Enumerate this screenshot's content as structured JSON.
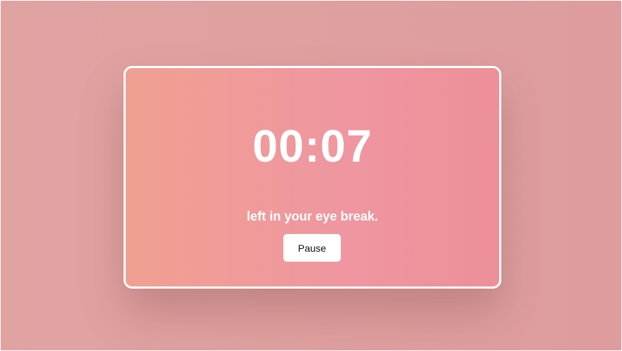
{
  "timer": {
    "remaining": "00:07",
    "subtitle": "left in your eye break."
  },
  "controls": {
    "pause_label": "Pause"
  }
}
